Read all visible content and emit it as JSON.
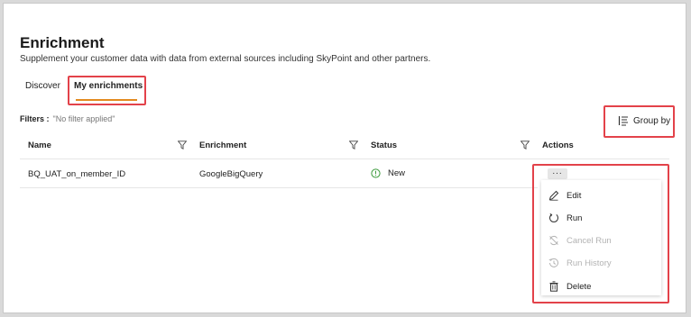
{
  "page": {
    "title": "Enrichment",
    "subtitle": "Supplement your customer data with data from external sources including SkyPoint and other partners."
  },
  "tabs": [
    {
      "label": "Discover",
      "active": false
    },
    {
      "label": "My enrichments",
      "active": true
    }
  ],
  "filters": {
    "label": "Filters :",
    "value": "\"No filter applied\""
  },
  "toolbar": {
    "group_by_label": "Group by"
  },
  "table": {
    "columns": [
      "Name",
      "Enrichment",
      "Status",
      "Actions"
    ],
    "rows": [
      {
        "name": "BQ_UAT_on_member_ID",
        "enrichment": "GoogleBigQuery",
        "status": "New"
      }
    ]
  },
  "actions_menu": {
    "more_label": "...",
    "items": [
      {
        "label": "Edit",
        "icon": "edit-icon",
        "enabled": true
      },
      {
        "label": "Run",
        "icon": "run-icon",
        "enabled": true
      },
      {
        "label": "Cancel Run",
        "icon": "cancel-run-icon",
        "enabled": false
      },
      {
        "label": "Run History",
        "icon": "history-icon",
        "enabled": false
      },
      {
        "label": "Delete",
        "icon": "trash-icon",
        "enabled": true
      }
    ]
  },
  "colors": {
    "accent": "#e38a1e",
    "highlight_box": "#e3424a",
    "status_new": "#3a9a3a",
    "disabled_text": "#b3b3b3"
  }
}
